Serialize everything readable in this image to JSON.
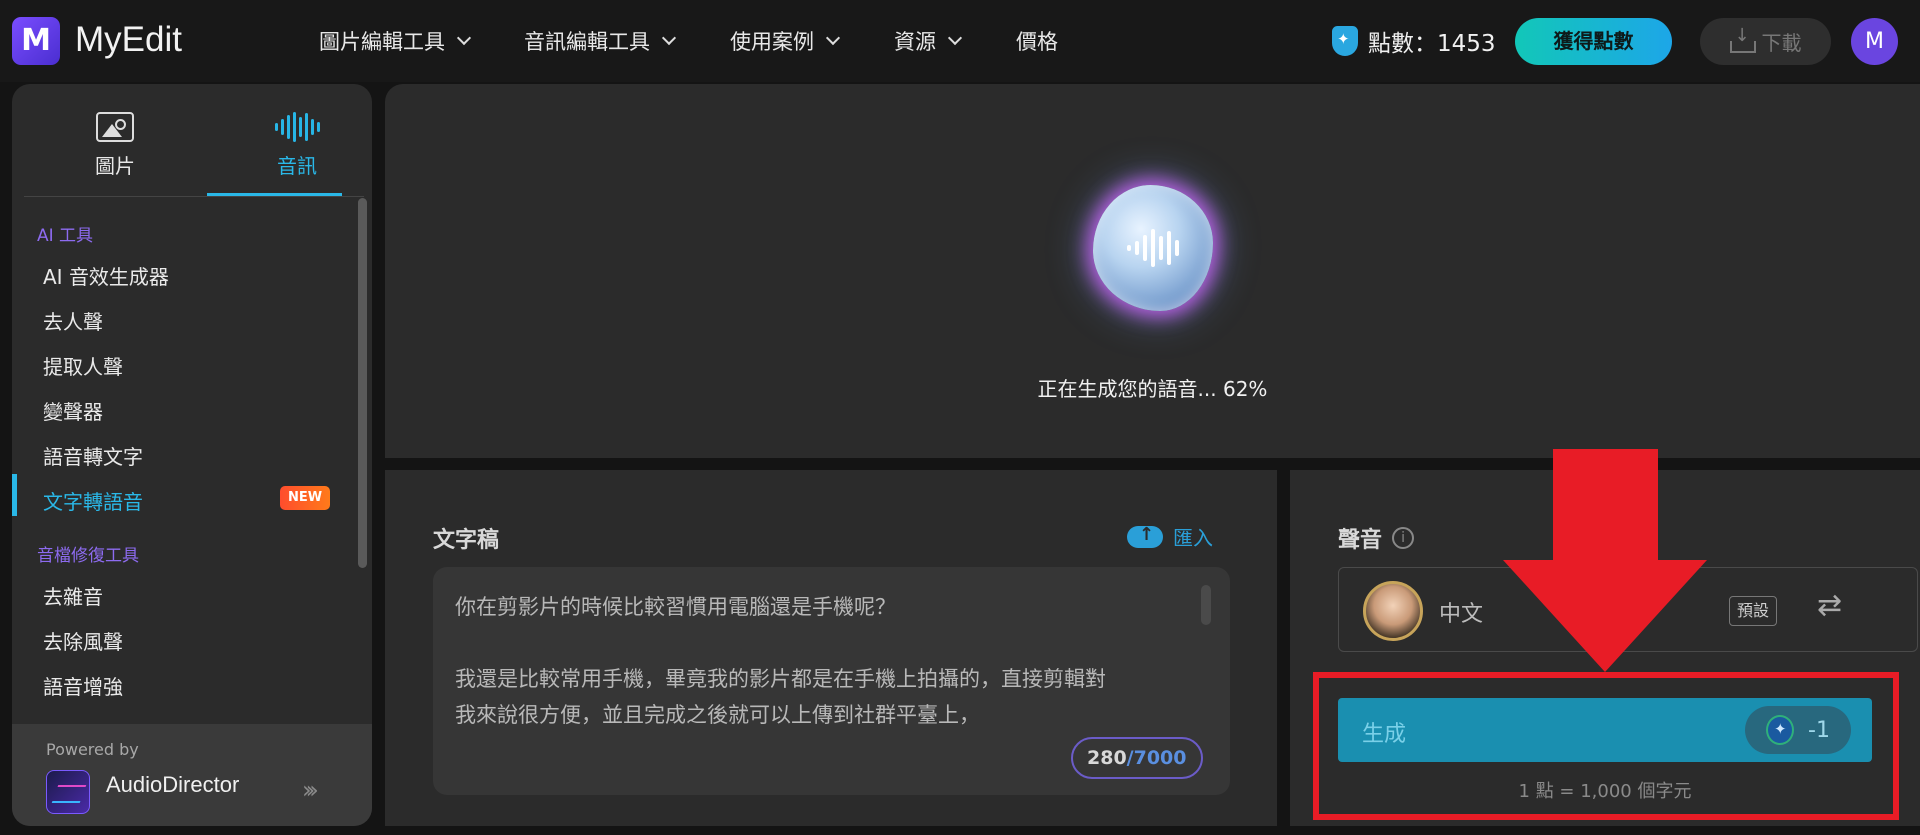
{
  "header": {
    "brand": "MyEdit",
    "logo_letter": "M",
    "nav": [
      {
        "label": "圖片編輯工具"
      },
      {
        "label": "音訊編輯工具"
      },
      {
        "label": "使用案例"
      },
      {
        "label": "資源"
      },
      {
        "label": "價格"
      }
    ],
    "points_label": "點數：1453",
    "get_points_label": "獲得點數",
    "download_label": "下載",
    "avatar_initial": "M"
  },
  "sidebar": {
    "tabs": [
      {
        "label": "圖片",
        "icon": "image-icon"
      },
      {
        "label": "音訊",
        "icon": "audio-wave-icon",
        "active": true
      }
    ],
    "sections": [
      {
        "title": "AI 工具",
        "items": [
          "AI 音效生成器",
          "去人聲",
          "提取人聲",
          "變聲器",
          "語音轉文字",
          "文字轉語音"
        ]
      },
      {
        "title": "音檔修復工具",
        "items": [
          "去雜音",
          "去除風聲",
          "語音增強"
        ]
      }
    ],
    "active_item": "文字轉語音",
    "new_badge": "NEW",
    "powered_by": "Powered by",
    "partner_name": "AudioDirector"
  },
  "generation": {
    "status": "正在生成您的語音... 62%",
    "progress_percent": 62
  },
  "script": {
    "title": "文字稿",
    "import_label": "匯入",
    "lines": [
      "你在剪影片的時候比較習慣用電腦還是手機呢？",
      "",
      "我還是比較常用手機，畢竟我的影片都是在手機上拍攝的，直接剪輯對",
      "我來說很方便，並且完成之後就可以上傳到社群平臺上，"
    ],
    "char_count": "280",
    "char_limit": "/7000"
  },
  "voice": {
    "title": "聲音",
    "info_glyph": "i",
    "selected_name": "中文",
    "default_badge": "預設",
    "generate_label": "生成",
    "cost": "-1",
    "rate_note": "1 點 = 1,000 個字元"
  },
  "colors": {
    "accent": "#2ab8e8",
    "section_title": "#8d6bf0",
    "annotation_red": "#e81c26",
    "generate_button": "#1a8fb0"
  }
}
